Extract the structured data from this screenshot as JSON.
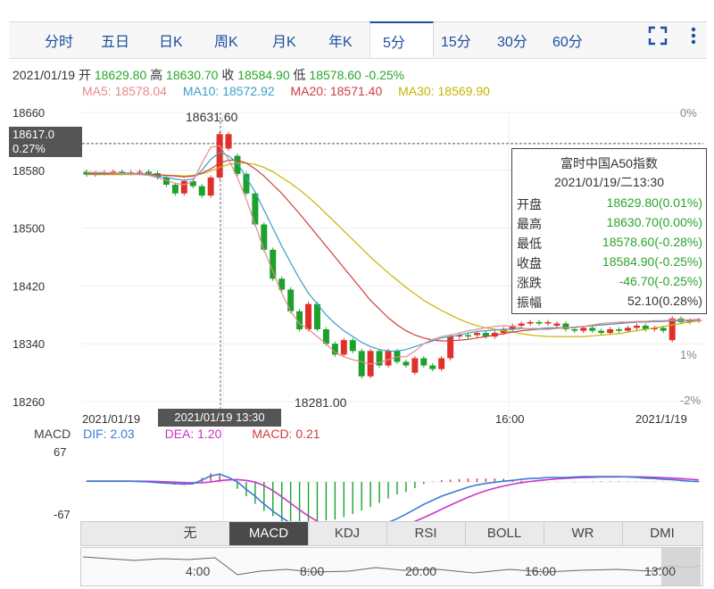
{
  "tabs": [
    "分时",
    "五日",
    "日K",
    "周K",
    "月K",
    "年K",
    "5分",
    "15分",
    "30分",
    "60分"
  ],
  "active_tab": "5分",
  "toolbar": {
    "fullscreen_icon": "fullscreen-icon",
    "more_icon": "more-icon"
  },
  "quote": {
    "date": "2021/01/19",
    "open_label": "开",
    "open": "18629.80",
    "high_label": "高",
    "high": "18630.70",
    "close_label": "收",
    "close": "18584.90",
    "low_label": "低",
    "low": "18578.60",
    "change": "-0.25%"
  },
  "ma_legend": [
    {
      "label": "MA5: 18578.04",
      "color": "#e88a8a"
    },
    {
      "label": "MA10: 18572.92",
      "color": "#3aa0c8"
    },
    {
      "label": "MA20: 18571.40",
      "color": "#d23c3c"
    },
    {
      "label": "MA30: 18569.90",
      "color": "#c8b400"
    }
  ],
  "crosshair": {
    "price": "18617.0",
    "pct": "0.27%",
    "time": "2021/01/19 13:30"
  },
  "tooltip": {
    "title": "富时中国A50指数",
    "time": "2021/01/19/二13:30",
    "rows": [
      {
        "label": "开盘",
        "value": "18629.80(0.01%)"
      },
      {
        "label": "最高",
        "value": "18630.70(0.00%)"
      },
      {
        "label": "最低",
        "value": "18578.60(-0.28%)"
      },
      {
        "label": "收盘",
        "value": "18584.90(-0.25%)"
      },
      {
        "label": "涨跌",
        "value": "-46.70(-0.25%)"
      },
      {
        "label": "振幅",
        "value": "52.10(0.28%)"
      }
    ]
  },
  "chart_data": {
    "type": "candlestick",
    "y_ticks": [
      "18660",
      "18580",
      "18500",
      "18420",
      "18340",
      "18260"
    ],
    "right_ticks": [
      "0%",
      "1%",
      "-2%"
    ],
    "x_labels": [
      "2021/01/19",
      "16:00",
      "2021/1/19"
    ],
    "annotations": {
      "high": "18631.60",
      "low": "18281.00"
    },
    "ylim": [
      18260,
      18660
    ],
    "candles": [
      {
        "o": 18578,
        "c": 18574
      },
      {
        "o": 18574,
        "c": 18576
      },
      {
        "o": 18576,
        "c": 18577
      },
      {
        "o": 18577,
        "c": 18578
      },
      {
        "o": 18578,
        "c": 18576
      },
      {
        "o": 18576,
        "c": 18577
      },
      {
        "o": 18577,
        "c": 18578
      },
      {
        "o": 18578,
        "c": 18576
      },
      {
        "o": 18576,
        "c": 18570
      },
      {
        "o": 18570,
        "c": 18560
      },
      {
        "o": 18560,
        "c": 18548
      },
      {
        "o": 18548,
        "c": 18565
      },
      {
        "o": 18565,
        "c": 18558
      },
      {
        "o": 18558,
        "c": 18545
      },
      {
        "o": 18545,
        "c": 18570
      },
      {
        "o": 18570,
        "c": 18630
      },
      {
        "o": 18610,
        "c": 18630
      },
      {
        "o": 18600,
        "c": 18575
      },
      {
        "o": 18575,
        "c": 18548
      },
      {
        "o": 18548,
        "c": 18505
      },
      {
        "o": 18505,
        "c": 18470
      },
      {
        "o": 18470,
        "c": 18430
      },
      {
        "o": 18430,
        "c": 18415
      },
      {
        "o": 18415,
        "c": 18385
      },
      {
        "o": 18385,
        "c": 18360
      },
      {
        "o": 18360,
        "c": 18395
      },
      {
        "o": 18395,
        "c": 18360
      },
      {
        "o": 18360,
        "c": 18340
      },
      {
        "o": 18340,
        "c": 18325
      },
      {
        "o": 18325,
        "c": 18345
      },
      {
        "o": 18345,
        "c": 18330
      },
      {
        "o": 18330,
        "c": 18295
      },
      {
        "o": 18295,
        "c": 18330
      },
      {
        "o": 18330,
        "c": 18310
      },
      {
        "o": 18310,
        "c": 18330
      },
      {
        "o": 18330,
        "c": 18315
      },
      {
        "o": 18315,
        "c": 18310
      },
      {
        "o": 18300,
        "c": 18320
      },
      {
        "o": 18320,
        "c": 18310
      },
      {
        "o": 18310,
        "c": 18305
      },
      {
        "o": 18305,
        "c": 18320
      },
      {
        "o": 18320,
        "c": 18350
      },
      {
        "o": 18350,
        "c": 18352
      },
      {
        "o": 18352,
        "c": 18350
      },
      {
        "o": 18352,
        "c": 18355
      },
      {
        "o": 18355,
        "c": 18350
      },
      {
        "o": 18350,
        "c": 18355
      },
      {
        "o": 18355,
        "c": 18360
      },
      {
        "o": 18360,
        "c": 18365
      },
      {
        "o": 18365,
        "c": 18368
      },
      {
        "o": 18368,
        "c": 18370
      },
      {
        "o": 18370,
        "c": 18368
      },
      {
        "o": 18368,
        "c": 18370
      },
      {
        "o": 18365,
        "c": 18368
      },
      {
        "o": 18368,
        "c": 18360
      },
      {
        "o": 18360,
        "c": 18358
      },
      {
        "o": 18358,
        "c": 18362
      },
      {
        "o": 18362,
        "c": 18358
      },
      {
        "o": 18358,
        "c": 18355
      },
      {
        "o": 18355,
        "c": 18360
      },
      {
        "o": 18360,
        "c": 18358
      },
      {
        "o": 18358,
        "c": 18362
      },
      {
        "o": 18362,
        "c": 18365
      },
      {
        "o": 18365,
        "c": 18360
      },
      {
        "o": 18360,
        "c": 18362
      },
      {
        "o": 18362,
        "c": 18358
      },
      {
        "o": 18345,
        "c": 18375
      },
      {
        "o": 18375,
        "c": 18370
      },
      {
        "o": 18370,
        "c": 18372
      },
      {
        "o": 18372,
        "c": 18373
      }
    ],
    "ma5": [
      18577,
      18577,
      18577,
      18576,
      18575,
      18575,
      18574,
      18573,
      18570,
      18566,
      18562,
      18560,
      18565,
      18590,
      18612,
      18614,
      18595,
      18570,
      18540,
      18505,
      18470,
      18440,
      18410,
      18385,
      18368,
      18360,
      18350,
      18340,
      18328,
      18322,
      18318,
      18315,
      18312,
      18314,
      18318,
      18322,
      18322,
      18330,
      18340,
      18346,
      18350,
      18352,
      18355,
      18358,
      18360,
      18362,
      18364,
      18365,
      18364,
      18362,
      18360,
      18360,
      18360,
      18361,
      18362,
      18362,
      18364,
      18366,
      18368,
      18369,
      18370,
      18370,
      18371,
      18371,
      18372,
      18372,
      18373,
      18373,
      18373,
      18374
    ],
    "ma10": [
      18576,
      18576,
      18576,
      18576,
      18576,
      18576,
      18575,
      18574,
      18572,
      18570,
      18568,
      18566,
      18568,
      18580,
      18595,
      18605,
      18600,
      18590,
      18570,
      18550,
      18525,
      18500,
      18475,
      18452,
      18430,
      18410,
      18395,
      18380,
      18368,
      18358,
      18350,
      18342,
      18336,
      18332,
      18330,
      18330,
      18332,
      18336,
      18340,
      18344,
      18348,
      18350,
      18352,
      18355,
      18357,
      18358,
      18359,
      18360,
      18360,
      18361,
      18361,
      18361,
      18362,
      18362,
      18362,
      18363,
      18364,
      18365,
      18366,
      18367,
      18368,
      18369,
      18370,
      18370,
      18371,
      18371,
      18372,
      18372,
      18372,
      18373
    ],
    "ma20": [
      18575,
      18575,
      18575,
      18575,
      18575,
      18575,
      18575,
      18575,
      18574,
      18573,
      18572,
      18571,
      18572,
      18576,
      18582,
      18590,
      18594,
      18594,
      18590,
      18582,
      18572,
      18560,
      18548,
      18534,
      18520,
      18505,
      18490,
      18475,
      18460,
      18445,
      18430,
      18415,
      18400,
      18388,
      18376,
      18366,
      18358,
      18352,
      18348,
      18345,
      18344,
      18344,
      18345,
      18346,
      18348,
      18350,
      18352,
      18354,
      18356,
      18358,
      18359,
      18360,
      18361,
      18362,
      18362,
      18363,
      18364,
      18365,
      18366,
      18367,
      18368,
      18369,
      18370,
      18370,
      18371,
      18371,
      18372,
      18372,
      18373,
      18373
    ],
    "ma30": [
      18574,
      18574,
      18574,
      18574,
      18574,
      18574,
      18574,
      18574,
      18574,
      18573,
      18573,
      18572,
      18573,
      18575,
      18579,
      18584,
      18588,
      18590,
      18590,
      18588,
      18584,
      18578,
      18570,
      18562,
      18553,
      18543,
      18532,
      18520,
      18508,
      18496,
      18484,
      18472,
      18460,
      18449,
      18438,
      18428,
      18418,
      18409,
      18400,
      18393,
      18386,
      18380,
      18374,
      18369,
      18365,
      18362,
      18360,
      18358,
      18356,
      18354,
      18352,
      18351,
      18350,
      18350,
      18350,
      18350,
      18350,
      18351,
      18352,
      18353,
      18354,
      18356,
      18358,
      18360,
      18362,
      18364,
      18366,
      18368,
      18370,
      18372
    ],
    "macd": {
      "dif": "2.03",
      "dea": "1.20",
      "macd": "0.21",
      "y_ticks": [
        "67",
        "-67"
      ]
    }
  },
  "macd_legend": [
    {
      "label": "MACD",
      "color": "#444"
    },
    {
      "label": "DIF: 2.03",
      "color": "#3a7bd5"
    },
    {
      "label": "DEA: 1.20",
      "color": "#cc33cc"
    },
    {
      "label": "MACD: 0.21",
      "color": "#d23c3c"
    }
  ],
  "indicators": [
    "无",
    "MACD",
    "KDJ",
    "RSI",
    "BOLL",
    "WR",
    "DMI"
  ],
  "active_indicator": "MACD",
  "navigator": {
    "labels": [
      "4:00",
      "8:00",
      "20:00",
      "16:00",
      "13:00"
    ]
  }
}
